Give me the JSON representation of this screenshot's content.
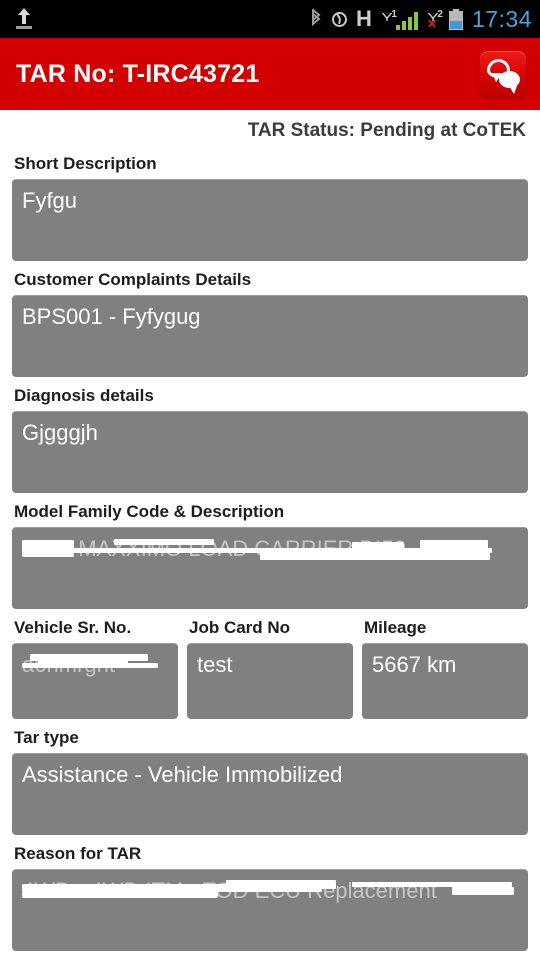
{
  "statusbar": {
    "time": "17:34",
    "icons": [
      "upload-icon",
      "bluetooth-icon",
      "alarm-icon",
      "network-h-icon",
      "signal-sim1-icon",
      "signal-sim2-x-icon",
      "battery-icon"
    ],
    "network_type": "H",
    "sim1_label": "1",
    "sim2_label": "2",
    "sim2_state": "x"
  },
  "header": {
    "title": "TAR No: T-IRC43721",
    "action_icon": "chat-bubbles-icon",
    "bg_color": "#d20000"
  },
  "status": {
    "text": "TAR Status: Pending at CoTEK"
  },
  "fields": {
    "short_description": {
      "label": "Short Description",
      "value": "Fyfgu"
    },
    "customer_complaints": {
      "label": "Customer Complaints Details",
      "value": "BPS001 - Fyfygug"
    },
    "diagnosis_details": {
      "label": "Diagnosis details",
      "value": "Gjgggjh"
    },
    "model_family": {
      "label": "Model Family Code & Description",
      "value": "005 - MAXXIMO LOAD CARRIER DI50"
    },
    "vehicle_sr_no": {
      "label": "Vehicle Sr. No.",
      "value": "a6hmrgnt"
    },
    "job_card_no": {
      "label": "Job Card No",
      "value": "test"
    },
    "mileage": {
      "label": "Mileage",
      "value": "5667 km"
    },
    "tar_type": {
      "label": "Tar type",
      "value": "Assistance - Vehicle Immobilized"
    },
    "reason_for_tar": {
      "label": "Reason for TAR",
      "value": "4WD - 4WD ITM - TOD ECU Replacement"
    }
  },
  "colors": {
    "field_bg": "#808080",
    "header_red": "#d20000",
    "clock_blue": "#4aa3df",
    "signal_green": "#8cc63f"
  }
}
